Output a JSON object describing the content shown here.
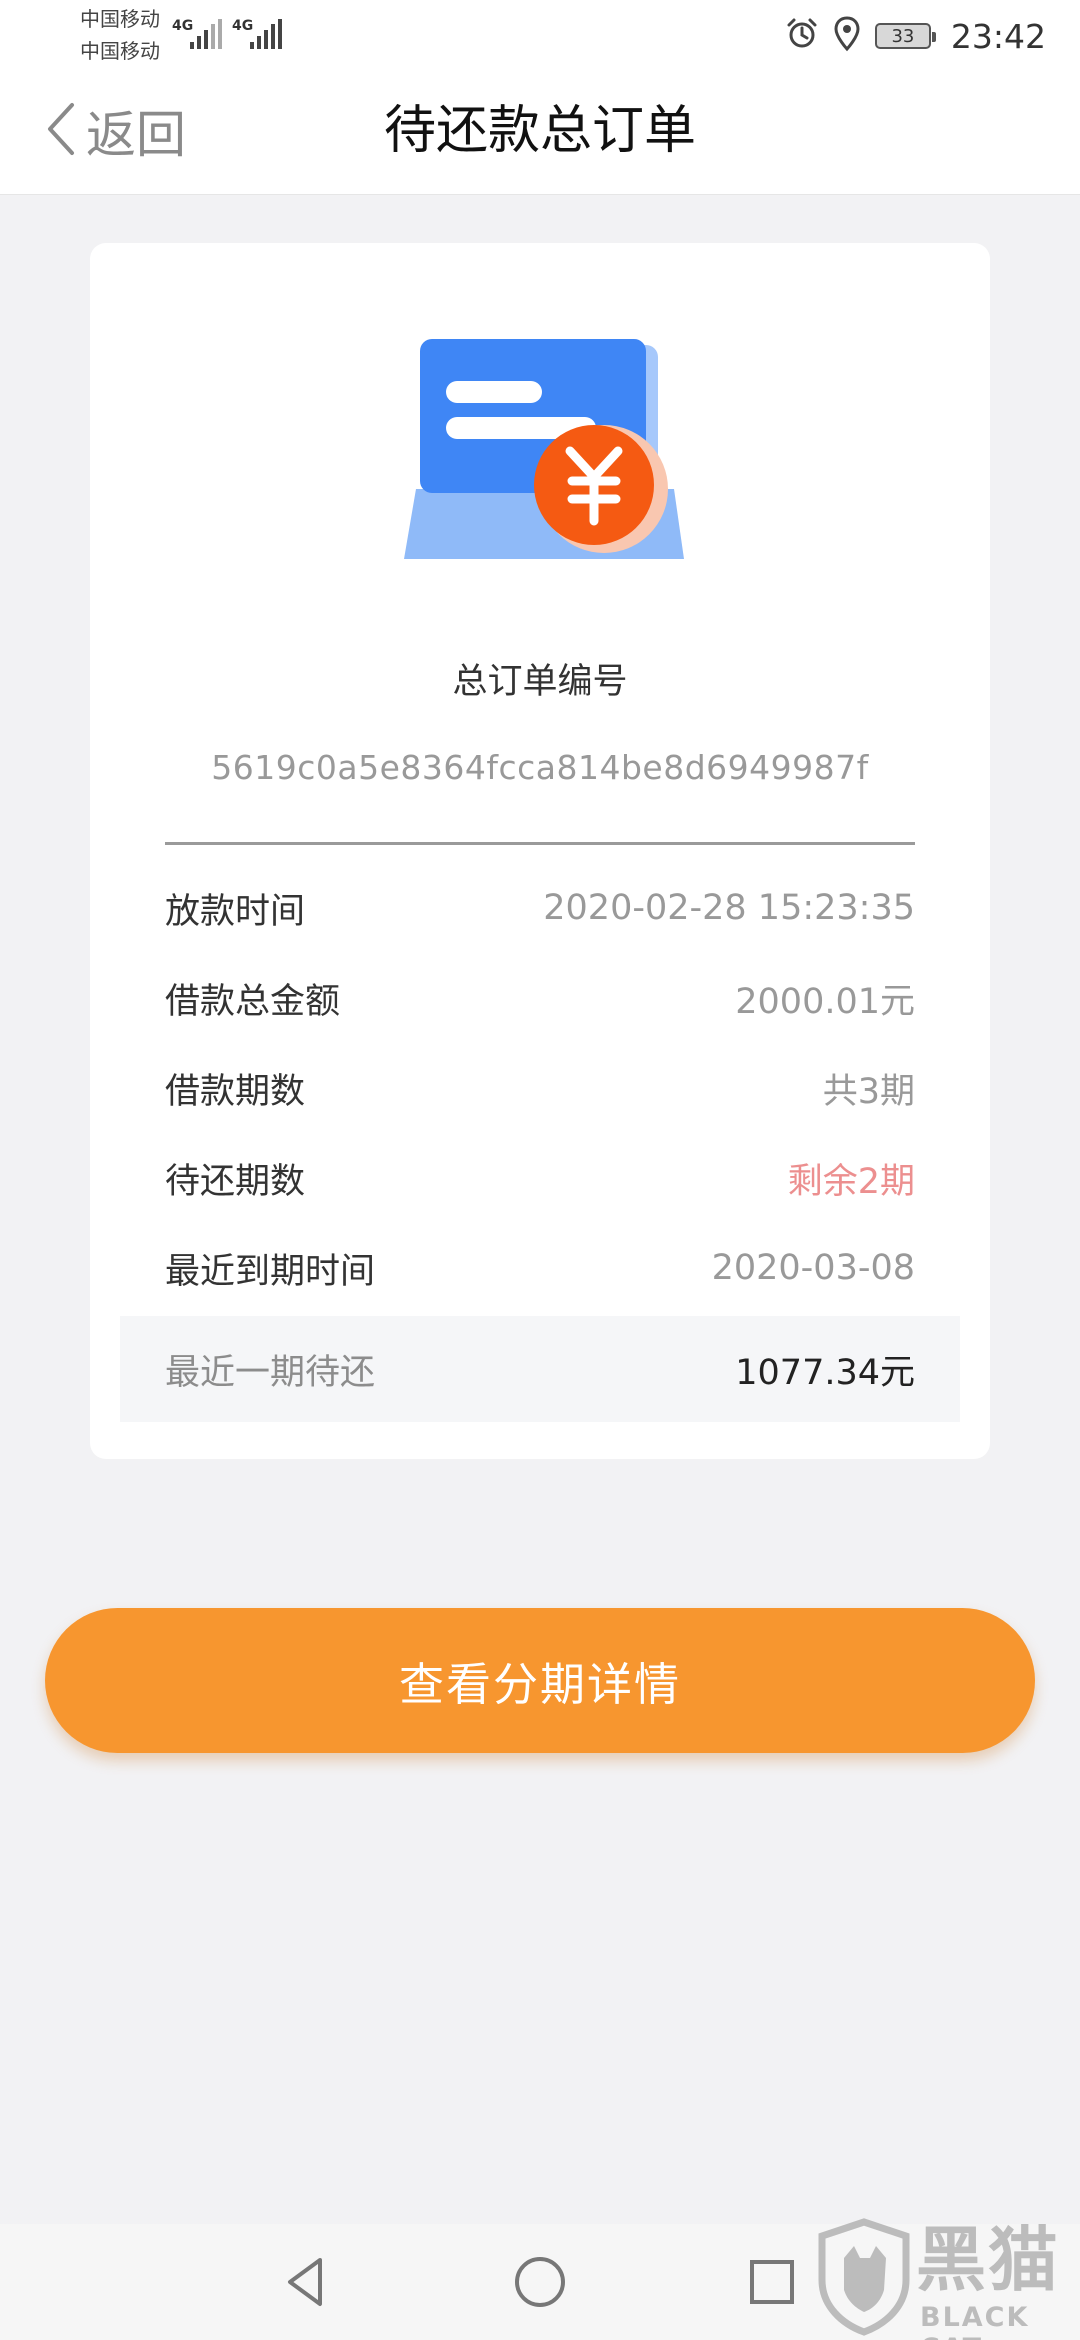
{
  "status_bar": {
    "carrier_1": "中国移动",
    "carrier_2": "中国移动",
    "network_1": "4G",
    "network_2": "4G",
    "battery": "33",
    "time": "23:42"
  },
  "nav": {
    "back_label": "返回",
    "title": "待还款总订单"
  },
  "order": {
    "number_label": "总订单编号",
    "number_value": "5619c0a5e8364fcca814be8d6949987f",
    "illustration_icon": "yen-invoice-icon",
    "rows": [
      {
        "label": "放款时间",
        "value": "2020-02-28 15:23:35"
      },
      {
        "label": "借款总金额",
        "value": "2000.01元"
      },
      {
        "label": "借款期数",
        "value": "共3期"
      },
      {
        "label": "待还期数",
        "value": "剩余2期"
      },
      {
        "label": "最近到期时间",
        "value": "2020-03-08"
      }
    ],
    "summary_label": "最近一期待还",
    "summary_value": "1077.34元"
  },
  "actions": {
    "view_installments": "查看分期详情"
  },
  "watermark": {
    "cn": "黑猫",
    "en": "BLACK CAT"
  },
  "colors": {
    "accent": "#f7962f",
    "highlight_red": "#ec8f8f",
    "illustration_blue": "#3f86f5",
    "illustration_orange": "#f55a12"
  }
}
